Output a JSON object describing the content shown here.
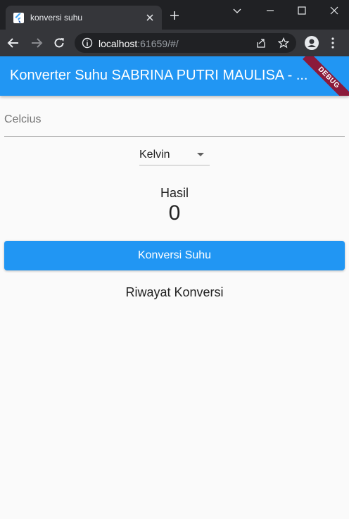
{
  "browser": {
    "tab_title": "konversi suhu",
    "url_host": "localhost",
    "url_rest": ":61659/#/"
  },
  "app": {
    "title": "Konverter Suhu SABRINA PUTRI MAULISA - ...",
    "debug_banner": "DEBUG"
  },
  "form": {
    "input_label": "Celcius",
    "dropdown_value": "Kelvin",
    "result_label": "Hasil",
    "result_value": "0",
    "convert_button": "Konversi Suhu",
    "history_label": "Riwayat Konversi"
  },
  "colors": {
    "primary": "#2196f3",
    "debug": "#8b1a3a"
  }
}
